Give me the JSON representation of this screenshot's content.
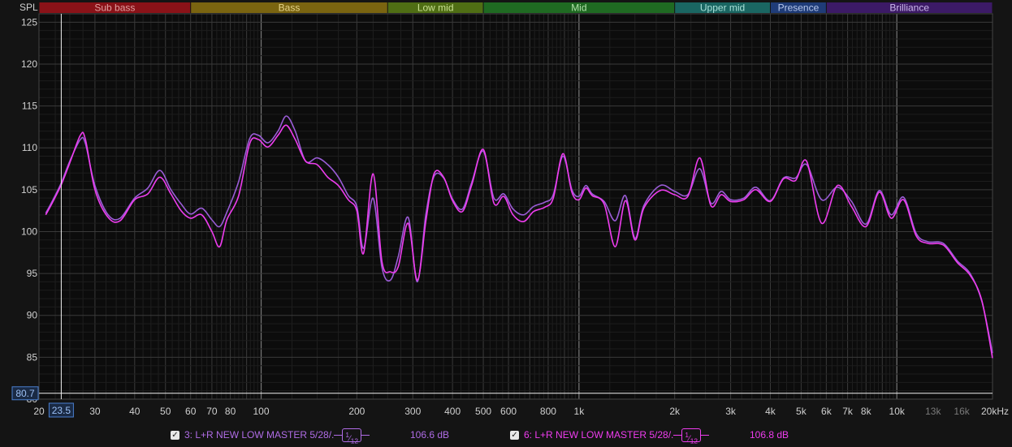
{
  "chart_data": {
    "type": "line",
    "ylabel": "SPL",
    "xscale": "log",
    "xlim": [
      20,
      20000
    ],
    "ylim": [
      80,
      126
    ],
    "grid": true,
    "yticks": [
      125,
      120,
      115,
      110,
      105,
      100,
      95,
      90,
      85,
      80
    ],
    "xticks": [
      {
        "v": 20,
        "label": "20",
        "dim": false
      },
      {
        "v": 30,
        "label": "30",
        "dim": false
      },
      {
        "v": 40,
        "label": "40",
        "dim": false
      },
      {
        "v": 50,
        "label": "50",
        "dim": false
      },
      {
        "v": 60,
        "label": "60",
        "dim": false
      },
      {
        "v": 70,
        "label": "70",
        "dim": false
      },
      {
        "v": 80,
        "label": "80",
        "dim": false
      },
      {
        "v": 100,
        "label": "100",
        "dim": false
      },
      {
        "v": 200,
        "label": "200",
        "dim": false
      },
      {
        "v": 300,
        "label": "300",
        "dim": false
      },
      {
        "v": 400,
        "label": "400",
        "dim": false
      },
      {
        "v": 500,
        "label": "500",
        "dim": false
      },
      {
        "v": 600,
        "label": "600",
        "dim": false
      },
      {
        "v": 800,
        "label": "800",
        "dim": false
      },
      {
        "v": 1000,
        "label": "1k",
        "dim": false
      },
      {
        "v": 2000,
        "label": "2k",
        "dim": false
      },
      {
        "v": 3000,
        "label": "3k",
        "dim": false
      },
      {
        "v": 4000,
        "label": "4k",
        "dim": false
      },
      {
        "v": 5000,
        "label": "5k",
        "dim": false
      },
      {
        "v": 6000,
        "label": "6k",
        "dim": false
      },
      {
        "v": 7000,
        "label": "7k",
        "dim": false
      },
      {
        "v": 8000,
        "label": "8k",
        "dim": false
      },
      {
        "v": 10000,
        "label": "10k",
        "dim": false
      },
      {
        "v": 13000,
        "label": "13k",
        "dim": true
      },
      {
        "v": 16000,
        "label": "16k",
        "dim": true
      },
      {
        "v": 20000,
        "label": "20kHz",
        "dim": false
      }
    ],
    "bands": [
      {
        "label": "Sub bass",
        "from": 20,
        "to": 60,
        "color": "#8a1218",
        "text": "#e0a0a0"
      },
      {
        "label": "Bass",
        "from": 60,
        "to": 250,
        "color": "#7a6410",
        "text": "#e6d48a"
      },
      {
        "label": "Low mid",
        "from": 250,
        "to": 500,
        "color": "#4f6e14",
        "text": "#c8e090"
      },
      {
        "label": "Mid",
        "from": 500,
        "to": 2000,
        "color": "#1f6a22",
        "text": "#b0e0a8"
      },
      {
        "label": "Upper mid",
        "from": 2000,
        "to": 4000,
        "color": "#1a6662",
        "text": "#a8e0d8"
      },
      {
        "label": "Presence",
        "from": 4000,
        "to": 6000,
        "color": "#1f3c78",
        "text": "#b8c8ec"
      },
      {
        "label": "Brilliance",
        "from": 6000,
        "to": 20000,
        "color": "#3c1a66",
        "text": "#ccb8ec"
      }
    ],
    "cursor": {
      "x": 23.5,
      "x_label": "23.5",
      "y": 80.7,
      "y_label": "80.7"
    },
    "series": [
      {
        "name": "3: L+R NEW LOW MASTER 5/28/.",
        "color": "#9a5cd6",
        "x": [
          21,
          22,
          23.5,
          25,
          27,
          28,
          30,
          33,
          36,
          40,
          44,
          48,
          52,
          56,
          60,
          65,
          70,
          74,
          78,
          85,
          92,
          98,
          105,
          113,
          120,
          128,
          138,
          150,
          162,
          175,
          188,
          200,
          210,
          225,
          240,
          255,
          270,
          290,
          310,
          330,
          350,
          375,
          400,
          430,
          460,
          500,
          540,
          580,
          620,
          670,
          720,
          780,
          830,
          890,
          950,
          1000,
          1050,
          1100,
          1200,
          1300,
          1400,
          1500,
          1600,
          1800,
          2000,
          2200,
          2400,
          2600,
          2800,
          3000,
          3300,
          3600,
          4000,
          4400,
          4800,
          5200,
          5800,
          6500,
          7200,
          8000,
          8800,
          9600,
          10500,
          11500,
          12500,
          14000,
          15500,
          17000,
          18500,
          20000
        ],
        "y": [
          102.2,
          103.6,
          105.8,
          108.4,
          111,
          110.5,
          105.5,
          102,
          101.6,
          104,
          105.2,
          107.3,
          105,
          103.3,
          102.1,
          102.8,
          101.4,
          100.6,
          102.3,
          106,
          111.1,
          111.5,
          110.6,
          112,
          113.8,
          112,
          108.4,
          108.8,
          108,
          106.5,
          104.3,
          103,
          98,
          104,
          95.7,
          94.2,
          97,
          101.7,
          94,
          102.1,
          106.6,
          106.4,
          103.9,
          102.7,
          105.9,
          109.6,
          104,
          104.5,
          102.7,
          102,
          103,
          103.5,
          104.4,
          109,
          105,
          104.2,
          105.5,
          104.5,
          103.6,
          101.3,
          104.3,
          99.2,
          103.1,
          105.5,
          104.8,
          104.4,
          107.5,
          103.4,
          104.8,
          103.8,
          104,
          105.3,
          103.7,
          106.4,
          106.4,
          108,
          103.8,
          105.3,
          103.6,
          100.9,
          104.9,
          102,
          104.1,
          99.8,
          98.8,
          98.6,
          96.5,
          95,
          91.7,
          85.5
        ]
      },
      {
        "name": "6: L+R NEW LOW MASTER 5/28/.",
        "color": "#ee3cee",
        "x": [
          21,
          22,
          23.5,
          25,
          27,
          28,
          30,
          33,
          36,
          40,
          44,
          48,
          52,
          56,
          60,
          65,
          70,
          74,
          78,
          85,
          92,
          98,
          105,
          113,
          120,
          128,
          138,
          150,
          162,
          175,
          188,
          200,
          210,
          225,
          240,
          255,
          270,
          290,
          310,
          330,
          350,
          375,
          400,
          430,
          460,
          500,
          540,
          580,
          620,
          670,
          720,
          780,
          830,
          890,
          950,
          1000,
          1050,
          1100,
          1200,
          1300,
          1400,
          1500,
          1600,
          1800,
          2000,
          2200,
          2400,
          2600,
          2800,
          3000,
          3300,
          3600,
          4000,
          4400,
          4800,
          5200,
          5800,
          6500,
          7200,
          8000,
          8800,
          9600,
          10500,
          11500,
          12500,
          14000,
          15500,
          17000,
          18500,
          20000
        ],
        "y": [
          102,
          103.4,
          105.6,
          108.2,
          111.5,
          111,
          105,
          101.7,
          101.3,
          103.8,
          104.5,
          106.5,
          104.5,
          102.5,
          101.6,
          102,
          100,
          98.2,
          101.4,
          104.3,
          110.5,
          111,
          110.1,
          111.5,
          112.7,
          111,
          108.4,
          108,
          106.5,
          105.5,
          103.8,
          102.5,
          97.4,
          106.9,
          96.4,
          95.2,
          95.8,
          101,
          94.2,
          101.3,
          106.9,
          106.5,
          103.7,
          102.4,
          105.6,
          109.8,
          103.4,
          104.2,
          102,
          101.2,
          102.4,
          102.9,
          104,
          109.3,
          104.7,
          103.8,
          105.2,
          104.3,
          103.3,
          98.2,
          103.7,
          99,
          102.8,
          104.9,
          104.4,
          104.2,
          108.8,
          103.1,
          104.4,
          103.6,
          103.8,
          105,
          103.6,
          106.3,
          106.1,
          108.4,
          101,
          105.5,
          103,
          100.6,
          104.7,
          101.6,
          103.8,
          99.5,
          98.6,
          98.4,
          96.3,
          94.8,
          91.8,
          84.9
        ]
      }
    ]
  },
  "legend": [
    {
      "checkbox": "✓",
      "label": "3: L+R NEW LOW MASTER 5/28/.",
      "smoothing_num": "1",
      "smoothing_den": "12",
      "value": "106.6 dB",
      "color": "#b06ce6"
    },
    {
      "checkbox": "✓",
      "label": "6: L+R NEW LOW MASTER 5/28/.",
      "smoothing_num": "1",
      "smoothing_den": "12",
      "value": "106.8 dB",
      "color": "#ee3cee"
    }
  ]
}
